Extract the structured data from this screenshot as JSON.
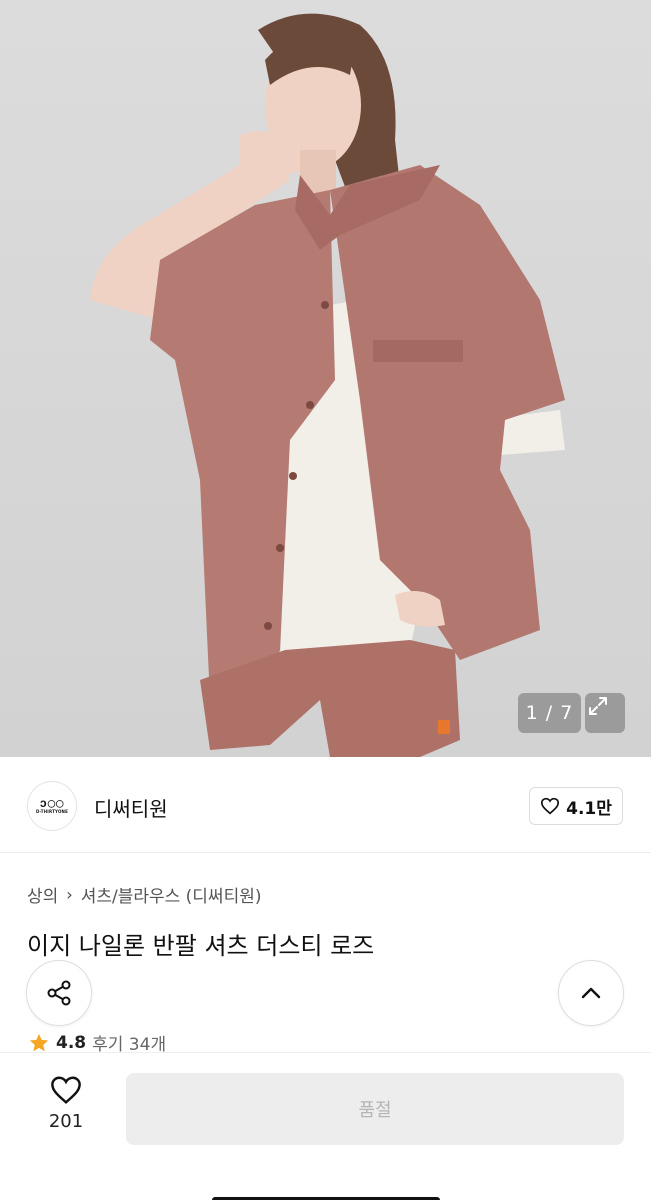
{
  "image_counter": "1 / 7",
  "brand": {
    "name": "디써티원",
    "logo_mark": "ↄ◯◯",
    "logo_sub": "D-THIRTYONE",
    "like_count": "4.1만"
  },
  "breadcrumb": {
    "category": "상의",
    "subcategory": "셔츠/블라우스 (디써티원)"
  },
  "product": {
    "title": "이지 나일론 반팔 셔츠 더스티 로즈",
    "rating": "4.8",
    "reviews": "후기 34개"
  },
  "bottom_bar": {
    "wish_count": "201",
    "soldout_label": "품절"
  },
  "colors": {
    "shirt": "#b57a72",
    "star": "#f5a623",
    "soldout_bg": "#ededed"
  }
}
